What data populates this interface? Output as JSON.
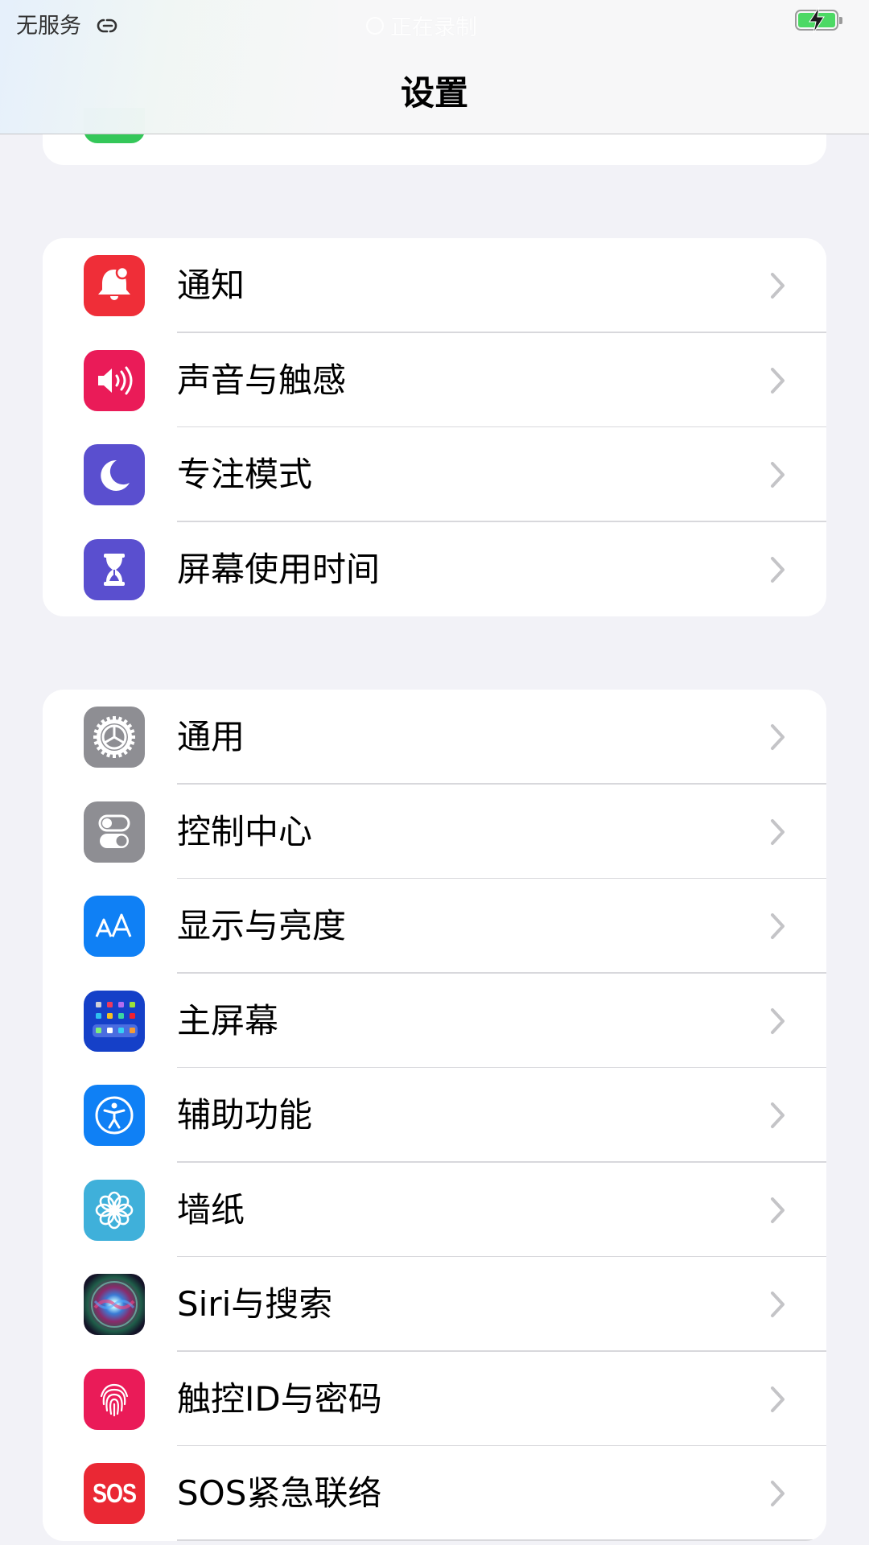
{
  "status_bar": {
    "carrier": "无服务",
    "carrier_icon": "link-icon",
    "recording_label": "正在录制",
    "battery_icon": "battery-charging-icon",
    "battery_color": "#4cd964"
  },
  "header": {
    "title": "设置"
  },
  "partial_group": {
    "icon": "green-app-icon",
    "icon_color": "#34c759"
  },
  "groups": [
    {
      "items": [
        {
          "label": "通知",
          "icon": "notification-bell-icon",
          "color": "#ef2e38"
        },
        {
          "label": "声音与触感",
          "icon": "speaker-icon",
          "color": "#ea1b58"
        },
        {
          "label": "专注模式",
          "icon": "moon-icon",
          "color": "#5a4fcf"
        },
        {
          "label": "屏幕使用时间",
          "icon": "hourglass-icon",
          "color": "#5a4fcf"
        }
      ]
    },
    {
      "items": [
        {
          "label": "通用",
          "icon": "gear-icon",
          "color": "#8e8e93"
        },
        {
          "label": "控制中心",
          "icon": "toggles-icon",
          "color": "#8e8e93"
        },
        {
          "label": "显示与亮度",
          "icon": "text-size-icon",
          "color": "#0f80f5"
        },
        {
          "label": "主屏幕",
          "icon": "home-screen-grid-icon",
          "color": "#1540c8"
        },
        {
          "label": "辅助功能",
          "icon": "accessibility-icon",
          "color": "#0f80f5"
        },
        {
          "label": "墙纸",
          "icon": "flower-icon",
          "color": "#3fb0da"
        },
        {
          "label": "Siri与搜索",
          "icon": "siri-icon",
          "color": "#1a1a2e"
        },
        {
          "label": "触控ID与密码",
          "icon": "fingerprint-icon",
          "color": "#ea1b58"
        },
        {
          "label": "SOS紧急联络",
          "icon": "sos-icon",
          "color": "#ea2834",
          "icon_text": "SOS"
        }
      ]
    }
  ],
  "chevron_icon": "chevron-right-icon"
}
